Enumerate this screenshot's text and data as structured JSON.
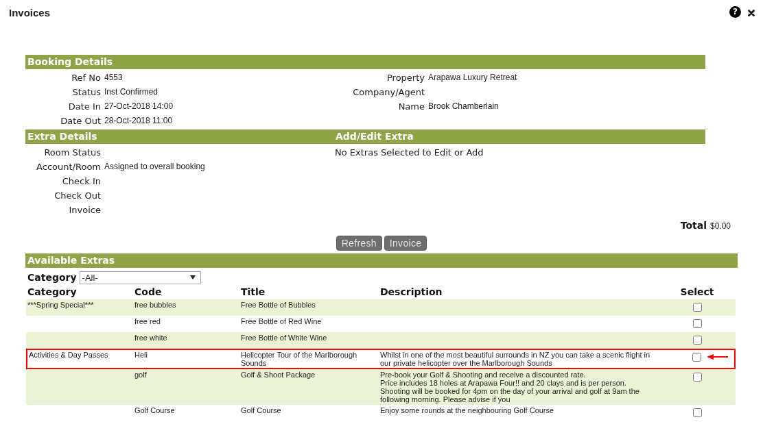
{
  "window": {
    "title": "Invoices",
    "help": "?"
  },
  "booking_details": {
    "title": "Booking Details",
    "left": [
      {
        "label": "Ref No",
        "value": "4553"
      },
      {
        "label": "Status",
        "value": "Inst Confirmed"
      },
      {
        "label": "Date In",
        "value": "27-Oct-2018 14:00"
      },
      {
        "label": "Date Out",
        "value": "28-Oct-2018 11:00"
      }
    ],
    "right": [
      {
        "label": "Property",
        "value": "Arapawa Luxury Retreat"
      },
      {
        "label": "Company/Agent"
      },
      {
        "label": "Name",
        "value": "Brook Chamberlain"
      }
    ]
  },
  "extra_details": {
    "title": "Extra Details",
    "rows": [
      {
        "label": "Room Status"
      },
      {
        "label": "Account/Room",
        "value": "Assigned to overall booking"
      },
      {
        "label": "Check In"
      },
      {
        "label": "Check Out"
      },
      {
        "label": "Invoice"
      }
    ]
  },
  "add_edit_extra": {
    "title": "Add/Edit Extra",
    "message": "No Extras Selected to Edit or Add"
  },
  "total": {
    "label": "Total",
    "value": "$0.00"
  },
  "buttons": [
    {
      "label": "Refresh"
    },
    {
      "label": "Invoice"
    }
  ],
  "available_extras": {
    "title": "Available Extras",
    "filter": {
      "label": "Category",
      "value": "-All-"
    },
    "columns": [
      "Category",
      "Code",
      "Title",
      "Description",
      "Select"
    ],
    "rows": [
      {
        "category": "***Spring Special***",
        "code": "free bubbles",
        "title": "Free Bottle of Bubbles",
        "checked": false,
        "highlighted": false
      },
      {
        "code": "free red",
        "title": "Free Bottle of Red Wine",
        "checked": false,
        "highlighted": false
      },
      {
        "code": "free white",
        "title": "Free Bottle of White Wine",
        "checked": false,
        "highlighted": false
      },
      {
        "category": "Activities & Day Passes",
        "code": "Heli",
        "title": "Helicopter Tour of the Marlborough Sounds",
        "description": "Whilst in one of the most beautiful surrounds in NZ you can take a scenic flight in our private helicopter over the Marlborough Sounds",
        "checked": false,
        "highlighted": true
      },
      {
        "code": "golf",
        "title": "Golf & Shoot Package",
        "description": "Pre-book your Golf & Shooting and receive a discounted rate.\nPrice includes 18 holes at Arapawa Four!! and 20 clays and is per person.\nShooting will be booked for 4pm on the day of your arrival and golf at 9am the following morning. Please advise if you",
        "checked": false,
        "highlighted": false
      },
      {
        "code": "Golf Course",
        "title": "Golf Course",
        "description": "Enjoy some rounds at the neighbouring Golf Course",
        "checked": false,
        "highlighted": false
      }
    ]
  }
}
